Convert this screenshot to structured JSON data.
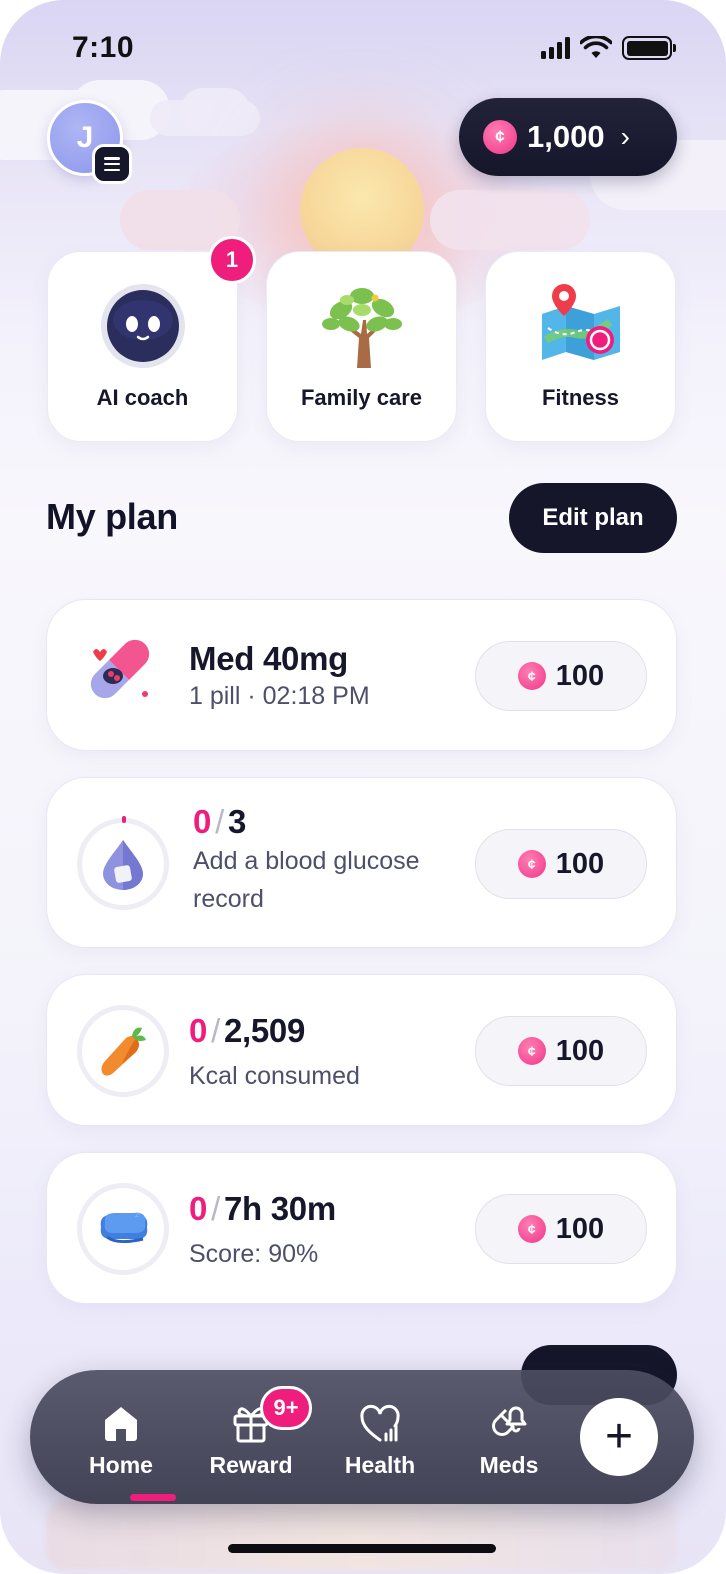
{
  "status_bar": {
    "time": "7:10"
  },
  "profile": {
    "initial": "J"
  },
  "wallet": {
    "coins": "1,000"
  },
  "shortcuts": [
    {
      "label": "AI coach",
      "badge": "1",
      "icon": "robot-icon"
    },
    {
      "label": "Family care",
      "icon": "tree-icon"
    },
    {
      "label": "Fitness",
      "icon": "map-pin-icon"
    }
  ],
  "my_plan": {
    "title": "My plan",
    "edit_label": "Edit plan",
    "items": [
      {
        "title": "Med 40mg",
        "subtitle": "1 pill · 02:18 PM",
        "reward": "100",
        "icon": "pill-icon"
      },
      {
        "current": "0",
        "target": "3",
        "subtitle_line1": "Add a blood glucose",
        "subtitle_line2": "record",
        "reward": "100",
        "icon": "blood-drop-icon",
        "progress": 0
      },
      {
        "current": "0",
        "target": "2,509",
        "subtitle": "Kcal consumed",
        "reward": "100",
        "icon": "carrot-icon",
        "progress": 0
      },
      {
        "current": "0",
        "target": "7h 30m",
        "subtitle": "Score: 90%",
        "reward": "100",
        "icon": "pillow-icon",
        "progress": 0
      }
    ]
  },
  "nav": {
    "items": [
      {
        "label": "Home",
        "icon": "home-icon",
        "active": true
      },
      {
        "label": "Reward",
        "icon": "gift-icon",
        "badge": "9+"
      },
      {
        "label": "Health",
        "icon": "heart-chart-icon"
      },
      {
        "label": "Meds",
        "icon": "pill-bell-icon"
      }
    ],
    "add_label": "+"
  },
  "colors": {
    "accent": "#ef1e7c",
    "dark": "#15162a"
  }
}
